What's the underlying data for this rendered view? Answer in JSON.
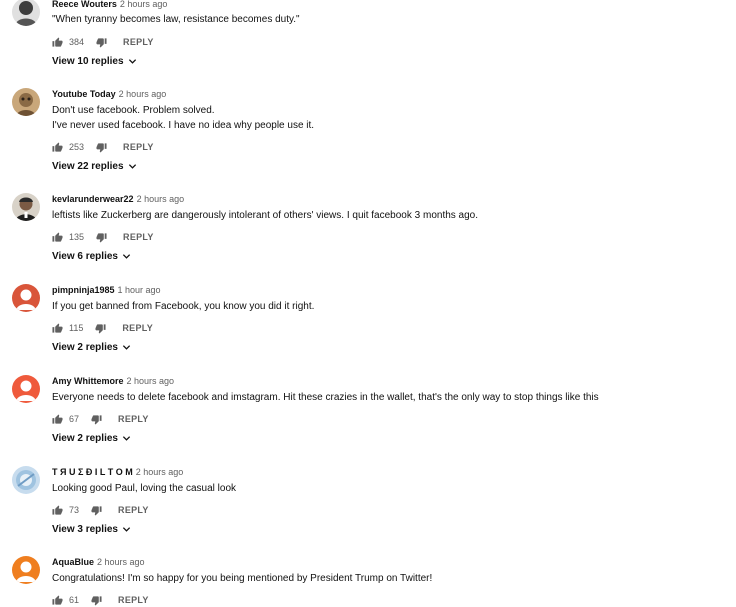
{
  "comments": [
    {
      "author": "Reece Wouters",
      "time": "2 hours ago",
      "lines": [
        "\"When tyranny becomes law, resistance becomes duty.\""
      ],
      "likes": "384",
      "reply_label": "REPLY",
      "view_replies": "View 10 replies",
      "avatar_color": "#3d3d3d"
    },
    {
      "author": "Youtube Today",
      "time": "2 hours ago",
      "lines": [
        "Don't use facebook. Problem solved.",
        "I've never used facebook. I have no idea why people use it."
      ],
      "likes": "253",
      "reply_label": "REPLY",
      "view_replies": "View 22 replies",
      "avatar_color": "#b58c5a"
    },
    {
      "author": "kevlarunderwear22",
      "time": "2 hours ago",
      "lines": [
        "leftists like Zuckerberg are dangerously intolerant of others' views. I quit facebook 3 months ago."
      ],
      "likes": "135",
      "reply_label": "REPLY",
      "view_replies": "View 6 replies",
      "avatar_color": "#5a4a3e"
    },
    {
      "author": "pimpninja1985",
      "time": "1 hour ago",
      "lines": [
        "If you get banned from Facebook, you know you did it right."
      ],
      "likes": "115",
      "reply_label": "REPLY",
      "view_replies": "View 2 replies",
      "avatar_color": "#d9553a"
    },
    {
      "author": "Amy Whittemore",
      "time": "2 hours ago",
      "lines": [
        "Everyone needs to delete facebook and imstagram. Hit these crazies in the wallet, that's the only way to stop things like this"
      ],
      "likes": "67",
      "reply_label": "REPLY",
      "view_replies": "View 2 replies",
      "avatar_color": "#ef5a3c"
    },
    {
      "author": "T Я U Σ Đ I L T O M",
      "time": "2 hours ago",
      "lines": [
        "Looking good Paul, loving the casual look"
      ],
      "likes": "73",
      "reply_label": "REPLY",
      "view_replies": "View 3 replies",
      "avatar_color": "#9fc3e0"
    },
    {
      "author": "AquaBlue",
      "time": "2 hours ago",
      "lines": [
        "Congratulations!  I'm so happy for you being mentioned by President Trump on Twitter!"
      ],
      "likes": "61",
      "reply_label": "REPLY",
      "view_replies": "",
      "avatar_color": "#ef7e1f"
    }
  ]
}
